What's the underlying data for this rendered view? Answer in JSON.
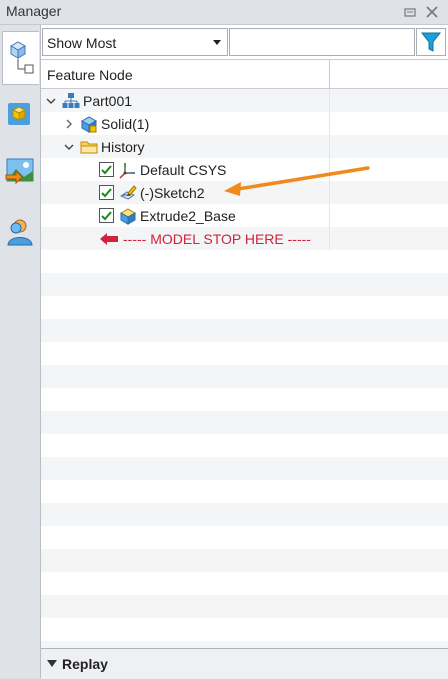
{
  "panel": {
    "title": "Manager"
  },
  "toolbar": {
    "display_mode": "Show Most",
    "filter_value": ""
  },
  "tree": {
    "column_header": "Feature Node",
    "nodes": [
      {
        "label": "Part001"
      },
      {
        "label": "Solid(1)"
      },
      {
        "label": "History"
      },
      {
        "label": "Default CSYS",
        "checked": true
      },
      {
        "label": "(-)Sketch2",
        "checked": true
      },
      {
        "label": "Extrude2_Base",
        "checked": true
      }
    ],
    "stop_marker": "----- MODEL STOP HERE -----"
  },
  "footer": {
    "replay_label": "Replay"
  },
  "colors": {
    "stop_marker": "#d0233a",
    "annotation_arrow": "#f08a1c",
    "filter_icon": "#1e9fd8"
  }
}
